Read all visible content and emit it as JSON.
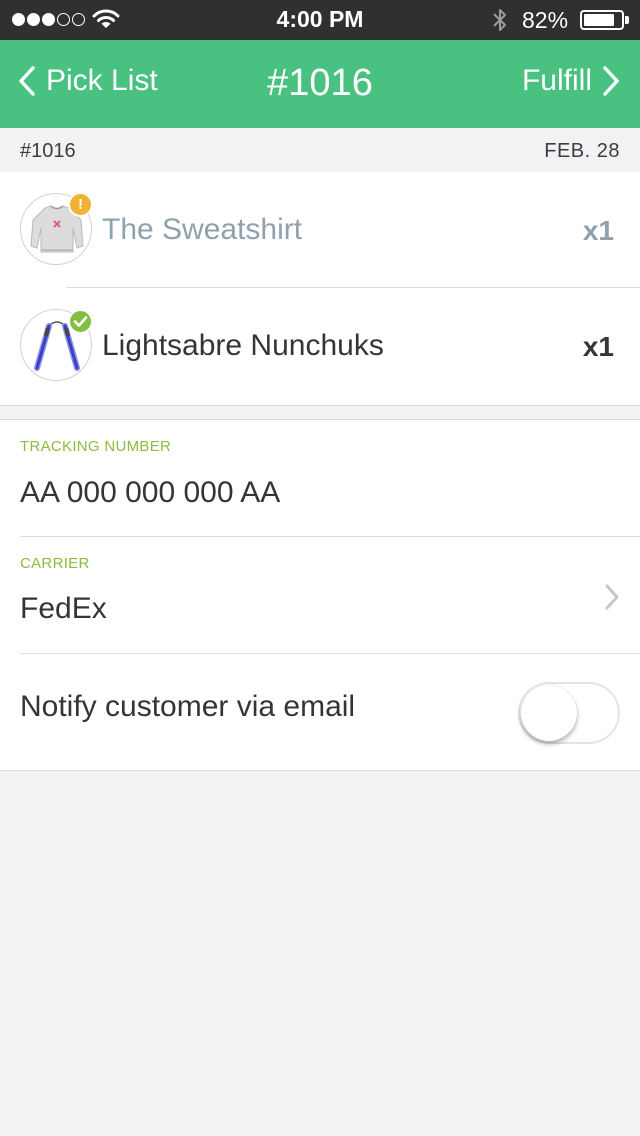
{
  "status_bar": {
    "signal_filled": 3,
    "signal_total": 5,
    "time": "4:00 PM",
    "battery_percent": "82%",
    "battery_level": 0.82,
    "icons": [
      "wifi-icon",
      "bluetooth-icon",
      "battery-icon"
    ]
  },
  "nav": {
    "back_label": "Pick List",
    "title": "#1016",
    "action_label": "Fulfill"
  },
  "order": {
    "number": "#1016",
    "date": "FEB. 28"
  },
  "items": [
    {
      "name": "The Sweatshirt",
      "quantity": "x1",
      "status": "warning",
      "status_glyph": "!",
      "image": "sweatshirt-thumbnail"
    },
    {
      "name": "Lightsabre Nunchuks",
      "quantity": "x1",
      "status": "complete",
      "status_glyph": "✓",
      "image": "nunchuks-thumbnail"
    }
  ],
  "form": {
    "tracking_label": "TRACKING NUMBER",
    "tracking_value": "AA 000 000 000 AA",
    "carrier_label": "CARRIER",
    "carrier_value": "FedEx",
    "notify_label": "Notify customer via email",
    "notify_enabled": false
  },
  "colors": {
    "nav_green": "#48c181",
    "label_green": "#8fbb3e",
    "warning": "#f0b232",
    "ok": "#82c044",
    "muted_text": "#8fa1ad"
  }
}
